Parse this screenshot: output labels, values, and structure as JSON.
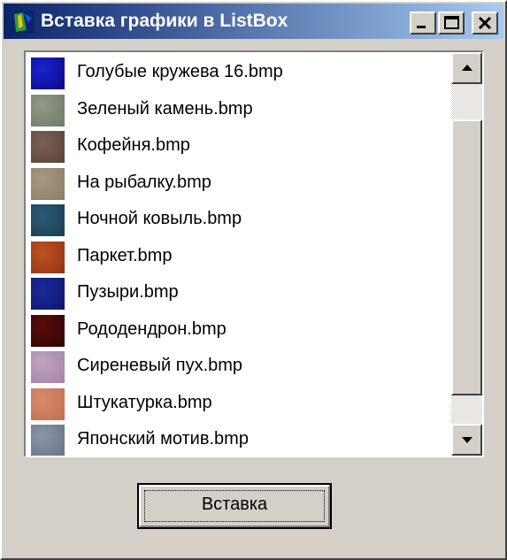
{
  "window": {
    "title": "Вставка графики в ListBox",
    "app_icon": "delphi-app-icon",
    "controls": {
      "minimize_icon": "minimize-icon",
      "maximize_icon": "maximize-icon",
      "close_icon": "close-icon"
    }
  },
  "listbox": {
    "items": [
      {
        "label": "Голубые кружева 16.bmp",
        "color": "#1a22cc",
        "color2": "#0a0a8a"
      },
      {
        "label": "Зеленый камень.bmp",
        "color": "#8e9a86",
        "color2": "#6f7b69"
      },
      {
        "label": "Кофейня.bmp",
        "color": "#7a6052",
        "color2": "#5a4438"
      },
      {
        "label": "На рыбалку.bmp",
        "color": "#a89a80",
        "color2": "#8a7c66"
      },
      {
        "label": "Ночной ковыль.bmp",
        "color": "#2a5a74",
        "color2": "#1a3e52"
      },
      {
        "label": "Паркет.bmp",
        "color": "#c05222",
        "color2": "#8e3412"
      },
      {
        "label": "Пузыри.bmp",
        "color": "#1c2a9a",
        "color2": "#0e166a"
      },
      {
        "label": "Рододендрон.bmp",
        "color": "#5a0c0c",
        "color2": "#2e0404"
      },
      {
        "label": "Сиреневый пух.bmp",
        "color": "#c0a2c0",
        "color2": "#a484a8"
      },
      {
        "label": "Штукатурка.bmp",
        "color": "#d88a6c",
        "color2": "#c07050"
      },
      {
        "label": "Японский мотив.bmp",
        "color": "#8a94aa",
        "color2": "#6a7488"
      }
    ],
    "scrollbar": {
      "up_icon": "arrow-up-icon",
      "down_icon": "arrow-down-icon"
    }
  },
  "insert_button": {
    "label": "Вставка"
  }
}
